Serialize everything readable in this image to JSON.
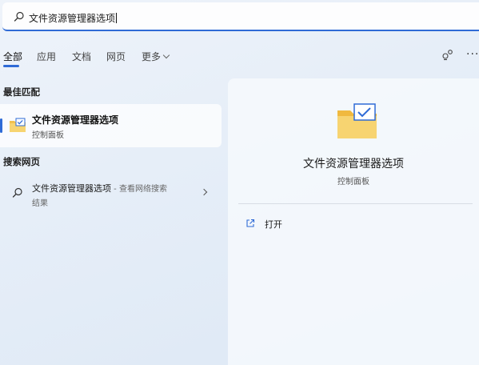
{
  "search": {
    "query": "文件资源管理器选项"
  },
  "tabs": [
    {
      "label": "全部"
    },
    {
      "label": "应用"
    },
    {
      "label": "文档"
    },
    {
      "label": "网页"
    },
    {
      "label": "更多"
    }
  ],
  "icons": {
    "search": "search-icon",
    "share": "share-icon",
    "more": "more-options-icon",
    "folder": "folder-check-icon",
    "open": "open-external-icon"
  },
  "colors": {
    "accent": "#2f6bd6",
    "folder": "#f2c14e"
  },
  "sections": {
    "best_match": "最佳匹配",
    "web_search": "搜索网页"
  },
  "best_match": {
    "title": "文件资源管理器选项",
    "subtitle": "控制面板"
  },
  "web_result": {
    "title": "文件资源管理器选项",
    "suffix": " - 查看网络搜索",
    "suffix_line2": "结果"
  },
  "more_glyph": "···",
  "detail": {
    "title": "文件资源管理器选项",
    "subtitle": "控制面板",
    "open_label": "打开"
  }
}
